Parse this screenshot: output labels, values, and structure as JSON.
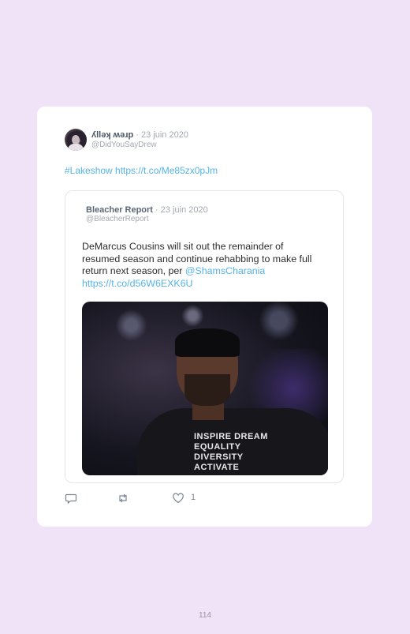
{
  "tweet": {
    "author_name": "ʎllǝʞ ʍǝɹp",
    "date": "· 23 juin 2020",
    "handle": "@DidYouSayDrew",
    "text": "#Lakeshow https://t.co/Me85zx0pJm",
    "like_count": "1"
  },
  "quoted": {
    "author_name": "Bleacher Report",
    "date": "· 23 juin 2020",
    "handle": "@BleacherReport",
    "text_before": "DeMarcus Cousins will sit out the remainder of resumed season and continue rehabbing to make full return next season, per ",
    "mention": "@ShamsCharania",
    "link": "https://t.co/d56W6EXK6U",
    "image_shirt_text": "INSPIRE DREAM EQUALITY DIVERSITY ACTIVATE"
  },
  "icons": [
    "reply-icon",
    "retweet-icon",
    "like-icon"
  ],
  "colors": {
    "background": "#f0e2f7",
    "link": "#55b3e8",
    "card": "#ffffff"
  },
  "page": {
    "number": "114"
  }
}
